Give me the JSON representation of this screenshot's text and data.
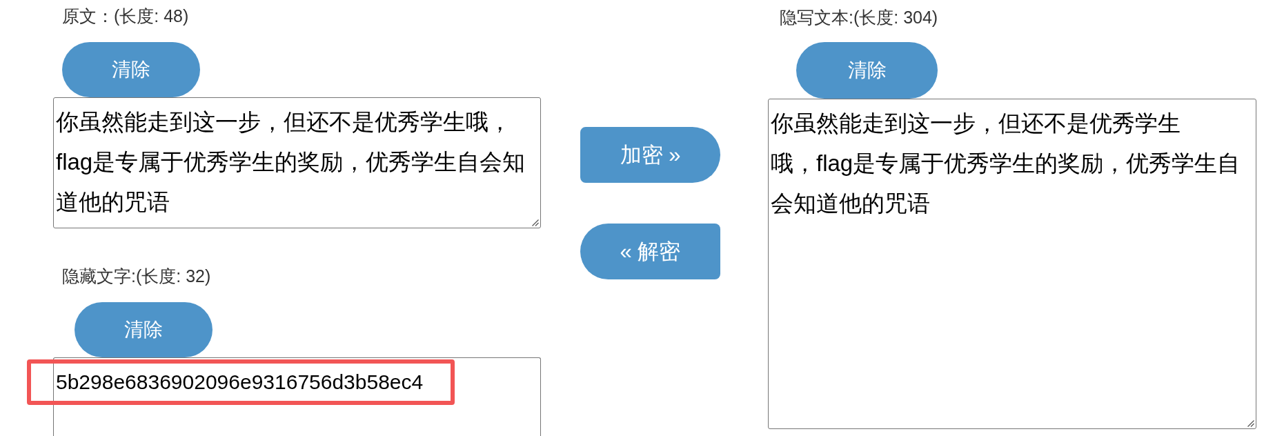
{
  "original": {
    "label": "原文：(长度: 48)",
    "clear_button": "清除",
    "value_lines": [
      "你虽然能走到这一步，但还不是优秀学生哦，",
      "flag是专属于优秀学生的奖励，优秀学生自会知",
      "道他的咒语"
    ]
  },
  "hidden": {
    "label": "隐藏文字:(长度: 32)",
    "clear_button": "清除",
    "value_lines": [
      "5b298e6836902096e9316756d3b58ec4"
    ],
    "highlighted": true
  },
  "actions": [
    {
      "label": "加密 »",
      "kind": "forward"
    },
    {
      "label": "« 解密",
      "kind": "back"
    }
  ],
  "stego": {
    "label": "隐写文本:(长度: 304)",
    "clear_button": "清除",
    "value_lines": [
      "你虽然能走到这一步，但还不是优秀学生",
      "哦，flag是专属于优秀学生的奖励，优秀学生自",
      "会知道他的咒语"
    ]
  }
}
